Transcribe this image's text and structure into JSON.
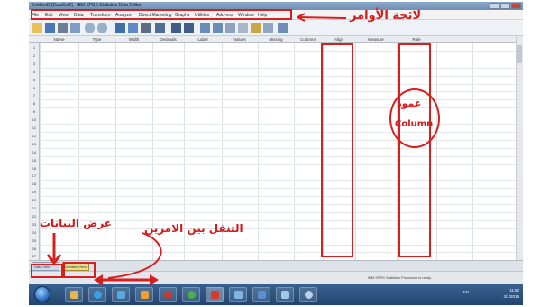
{
  "window": {
    "title": "Untitled1 [DataSet0] - IBM SPSS Statistics Data Editor"
  },
  "menu": {
    "items": [
      "File",
      "Edit",
      "View",
      "Data",
      "Transform",
      "Analyze",
      "Direct Marketing",
      "Graphs",
      "Utilities",
      "Add-ons",
      "Window",
      "Help"
    ]
  },
  "grid": {
    "columns": [
      "Name",
      "Type",
      "Width",
      "Decimals",
      "Label",
      "Values",
      "Missing",
      "Columns",
      "Align",
      "Measure",
      "Role"
    ],
    "rows": [
      "1",
      "2",
      "3",
      "4",
      "5",
      "6",
      "7",
      "8",
      "9",
      "10",
      "11",
      "12",
      "13",
      "14",
      "15",
      "16",
      "17",
      "18",
      "19",
      "20",
      "21",
      "22",
      "23",
      "24",
      "25",
      "26",
      "27"
    ]
  },
  "tabs": {
    "data_view": "Data View",
    "variable_view": "Variable View"
  },
  "status": {
    "text": "IBM SPSS Statistics Processor is ready"
  },
  "taskbar": {
    "tray": "EN",
    "time": "11:52",
    "date": "3/1/2016"
  },
  "annotations": {
    "menu_bar_label": "لائحة الأوامر",
    "column_ar": "عمود",
    "column_en": "Column",
    "view_data_label": "عرض البيانات",
    "switch_label": "التنقل بين الامرين"
  },
  "colors": {
    "annotation_red": "#d62020",
    "variable_view_tab": "#f2e087"
  }
}
